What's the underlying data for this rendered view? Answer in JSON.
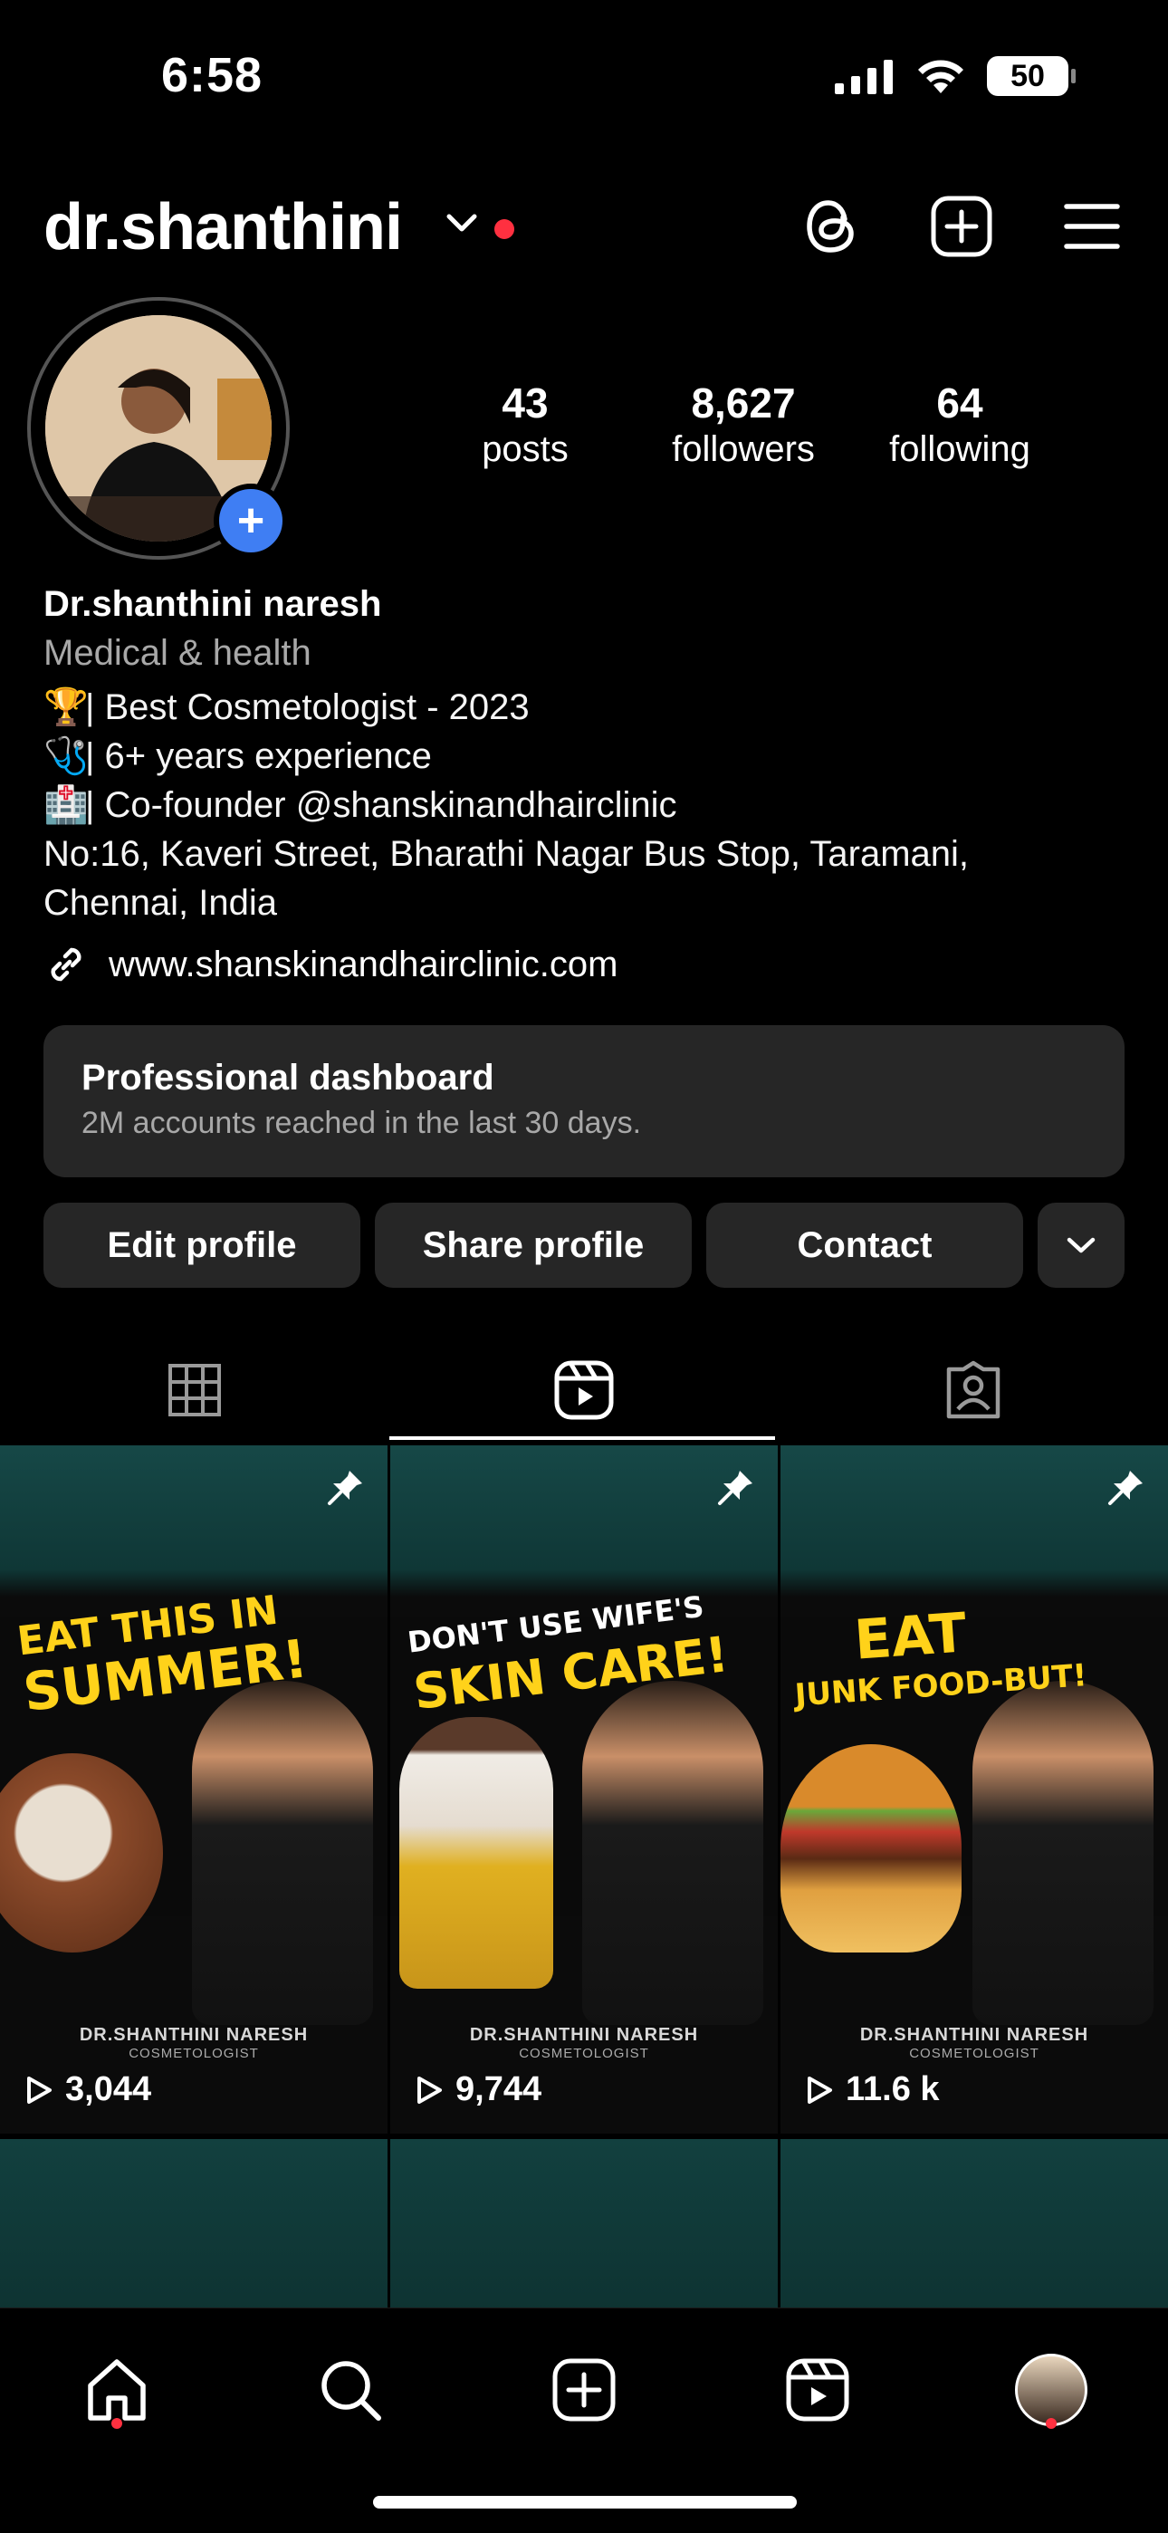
{
  "status": {
    "time": "6:58",
    "battery": "50"
  },
  "header": {
    "username": "dr.shanthini"
  },
  "stats": [
    {
      "value": "43",
      "label": "posts"
    },
    {
      "value": "8,627",
      "label": "followers"
    },
    {
      "value": "64",
      "label": "following"
    }
  ],
  "bio": {
    "name": "Dr.shanthini naresh",
    "category": "Medical & health",
    "lines": [
      {
        "emoji": "🏆",
        "text": "| Best Cosmetologist - 2023"
      },
      {
        "emoji": "🩺",
        "text": "| 6+ years experience"
      },
      {
        "emoji": "🏥",
        "text": "| Co-founder @shanskinandhairclinic"
      }
    ],
    "address_line1": "No:16, Kaveri Street, Bharathi Nagar Bus Stop, Taramani,",
    "address_line2": "Chennai, India",
    "link": "www.shanskinandhairclinic.com"
  },
  "dashboard": {
    "title": "Professional dashboard",
    "subtitle": "2M accounts reached in the last 30 days."
  },
  "buttons": {
    "edit": "Edit profile",
    "share": "Share profile",
    "contact": "Contact"
  },
  "reels": [
    {
      "headline_top": "EAT THIS IN",
      "headline_bottom": "SUMMER!",
      "caption": "DR.SHANTHINI NARESH",
      "caption_sub": "COSMETOLOGIST",
      "views": "3,044"
    },
    {
      "headline_top": "DON'T USE WIFE'S",
      "headline_bottom": "SKIN CARE!",
      "caption": "DR.SHANTHINI NARESH",
      "caption_sub": "COSMETOLOGIST",
      "views": "9,744"
    },
    {
      "headline_top": "EAT",
      "headline_bottom": "JUNK FOOD-BUT!",
      "caption": "DR.SHANTHINI NARESH",
      "caption_sub": "COSMETOLOGIST",
      "views": "11.6 k"
    }
  ],
  "colors": {
    "accent_red": "#ff3040",
    "accent_blue": "#3f7ef3",
    "headline_yellow": "#ffd21a",
    "surface": "#262626"
  },
  "icons": {
    "header": [
      "threads-icon",
      "new-post-icon",
      "menu-icon"
    ],
    "tabs": [
      "grid-icon",
      "reels-icon",
      "tagged-icon"
    ],
    "nav": [
      "home-icon",
      "search-icon",
      "create-icon",
      "reels-icon",
      "profile-avatar"
    ]
  }
}
